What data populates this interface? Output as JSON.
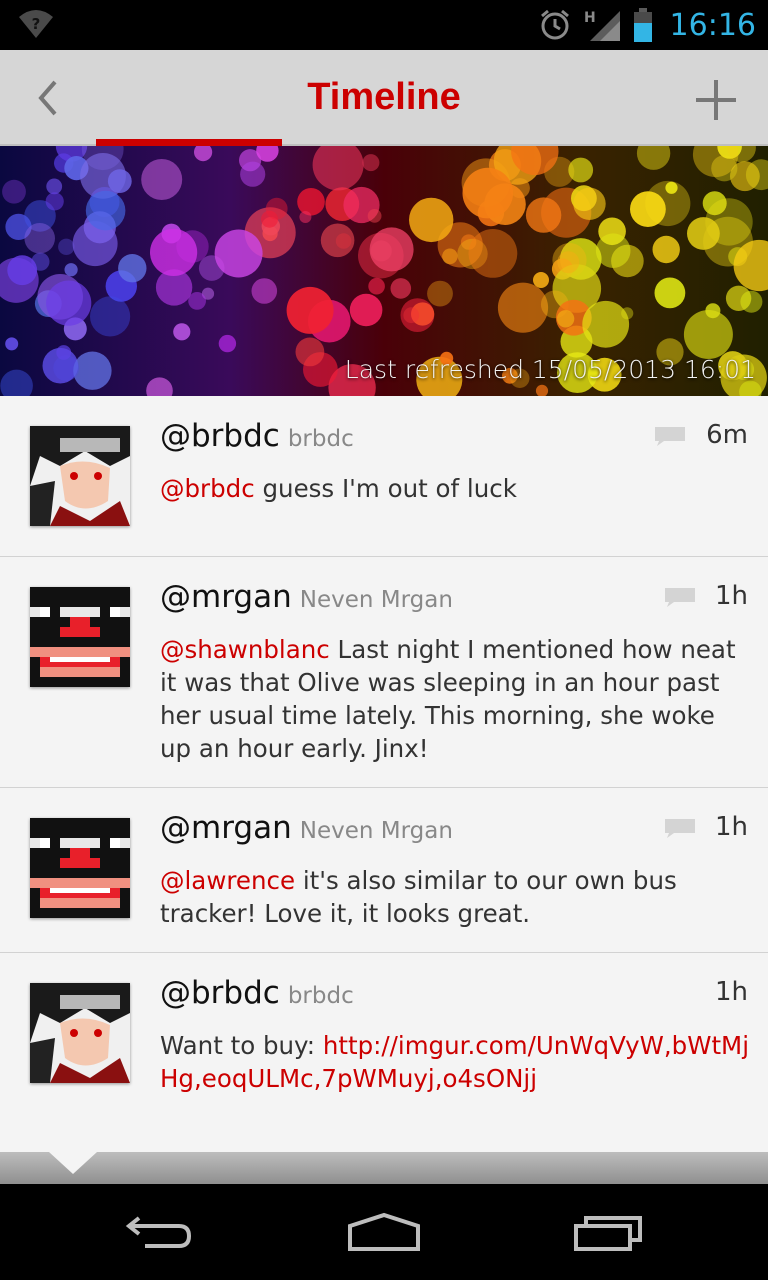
{
  "status_bar": {
    "time": "16:16",
    "network_label": "H",
    "icons": [
      "wifi-unknown-icon",
      "alarm-icon",
      "signal-icon",
      "battery-icon"
    ]
  },
  "action_bar": {
    "title": "Timeline",
    "back_icon": "chevron-left-icon",
    "add_icon": "plus-icon",
    "accent_color": "#cc0000"
  },
  "banner": {
    "last_refreshed": "Last refreshed 15/05/2013 16:01"
  },
  "tweets": [
    {
      "handle": "@brbdc",
      "name": "brbdc",
      "time": "6m",
      "has_reply_icon": true,
      "mention": "@brbdc",
      "text": " guess I'm out of luck",
      "avatar": "anime-avatar"
    },
    {
      "handle": "@mrgan",
      "name": "Neven Mrgan",
      "time": "1h",
      "has_reply_icon": true,
      "mention": "@shawnblanc",
      "text": " Last night I mentioned how neat it was that Olive was sleeping in an hour past her usual time lately. This morning, she woke up an hour early. Jinx!",
      "avatar": "pixel-face-avatar"
    },
    {
      "handle": "@mrgan",
      "name": "Neven Mrgan",
      "time": "1h",
      "has_reply_icon": true,
      "mention": "@lawrence",
      "text": " it's also similar to our own bus tracker! Love it, it looks great.",
      "avatar": "pixel-face-avatar"
    },
    {
      "handle": "@brbdc",
      "name": "brbdc",
      "time": "1h",
      "has_reply_icon": false,
      "text": "Want to buy: ",
      "link": "http://imgur.com/UnWqVyW,bWtMjHg,eoqULMc,7pWMuyj,o4sONjj",
      "avatar": "anime-avatar"
    }
  ],
  "nav_bar": {
    "icons": [
      "back-nav-icon",
      "home-nav-icon",
      "recents-nav-icon"
    ]
  }
}
